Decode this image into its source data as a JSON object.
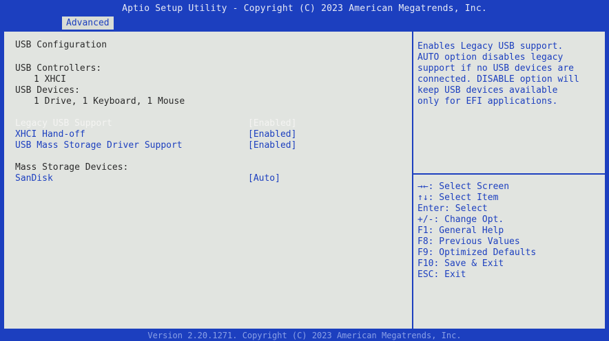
{
  "header": {
    "title": "Aptio Setup Utility - Copyright (C) 2023 American Megatrends, Inc.",
    "active_tab": "Advanced"
  },
  "main": {
    "section_title": "USB Configuration",
    "controllers_label": "USB Controllers:",
    "controllers_value": "1 XHCI",
    "devices_label": "USB Devices:",
    "devices_value": "1 Drive, 1 Keyboard, 1 Mouse",
    "settings": [
      {
        "label": "Legacy USB Support",
        "value": "[Enabled]"
      },
      {
        "label": "XHCI Hand-off",
        "value": "[Enabled]"
      },
      {
        "label": "USB Mass Storage Driver Support",
        "value": "[Enabled]"
      }
    ],
    "mass_storage_label": "Mass Storage Devices:",
    "mass_storage_devices": [
      {
        "label": "SanDisk",
        "value": "[Auto]"
      }
    ]
  },
  "help": {
    "lines": [
      "Enables Legacy USB support.",
      "AUTO option disables legacy",
      "support if no USB devices are",
      "connected. DISABLE option will",
      "keep USB devices available",
      "only for EFI applications."
    ]
  },
  "keys": {
    "lines": [
      "→←: Select Screen",
      "↑↓: Select Item",
      "Enter: Select",
      "+/-: Change Opt.",
      "F1: General Help",
      "F8: Previous Values",
      "F9: Optimized Defaults",
      "F10: Save & Exit",
      "ESC: Exit"
    ]
  },
  "footer": {
    "text": "Version 2.20.1271. Copyright (C) 2023 American Megatrends, Inc."
  },
  "colors": {
    "bios_blue": "#1c3fbf",
    "panel_bg": "#e1e4e0",
    "selected_text": "#f4f4f2"
  }
}
